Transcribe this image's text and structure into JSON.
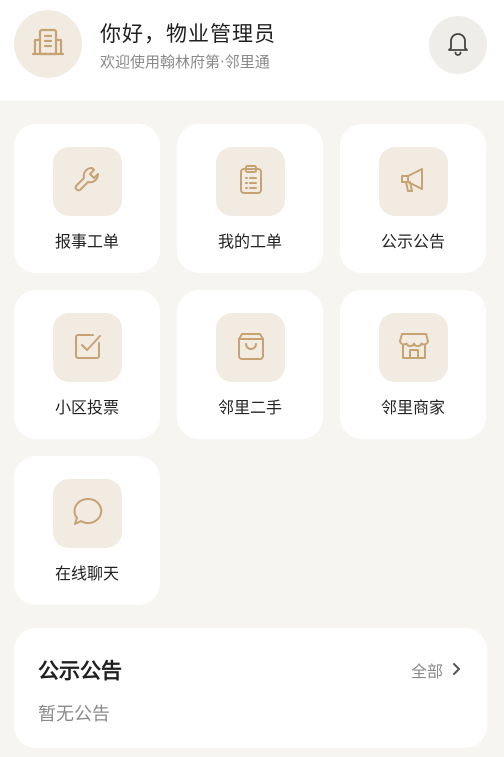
{
  "header": {
    "greeting": "你好，物业管理员",
    "subtitle": "欢迎使用翰林府第·邻里通",
    "avatar_icon": "building-icon",
    "bell_icon": "bell-icon"
  },
  "menu": {
    "items": [
      {
        "label": "报事工单",
        "icon": "wrench-icon"
      },
      {
        "label": "我的工单",
        "icon": "clipboard-icon"
      },
      {
        "label": "公示公告",
        "icon": "megaphone-icon"
      },
      {
        "label": "小区投票",
        "icon": "checkbox-icon"
      },
      {
        "label": "邻里二手",
        "icon": "shopping-bag-icon"
      },
      {
        "label": "邻里商家",
        "icon": "store-icon"
      },
      {
        "label": "在线聊天",
        "icon": "chat-bubble-icon"
      }
    ]
  },
  "notice": {
    "title": "公示公告",
    "all_label": "全部",
    "empty_text": "暂无公告"
  },
  "colors": {
    "accent": "#c7a273",
    "icon_bg": "#f1ebe2",
    "page_bg": "#f6f5f2"
  }
}
